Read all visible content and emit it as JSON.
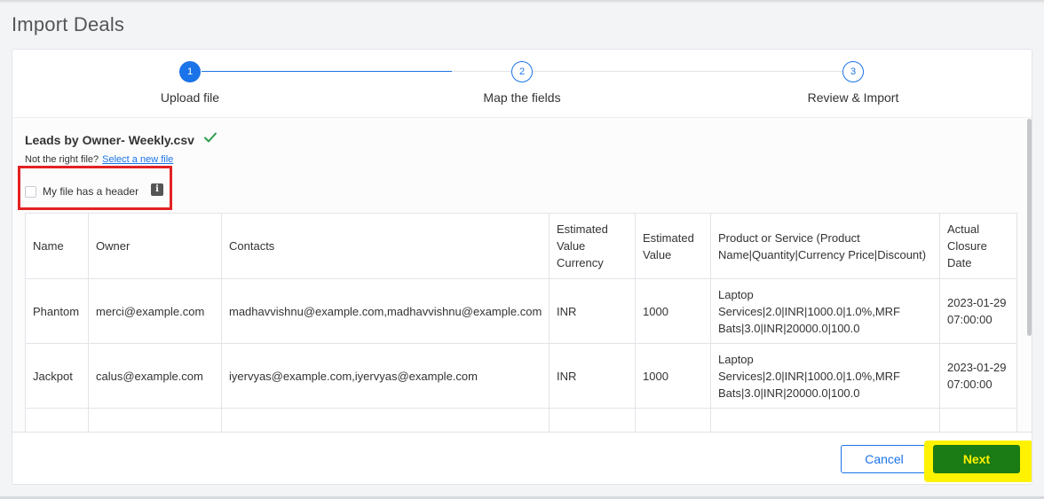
{
  "page": {
    "title": "Import Deals"
  },
  "stepper": {
    "steps": [
      {
        "number": "1",
        "label": "Upload file",
        "state": "active"
      },
      {
        "number": "2",
        "label": "Map the fields",
        "state": "idle"
      },
      {
        "number": "3",
        "label": "Review & Import",
        "state": "idle"
      }
    ]
  },
  "file": {
    "name": "Leads by Owner- Weekly.csv",
    "status_icon": "check-icon",
    "wrong_file_text": "Not the right file?",
    "select_new_link": "Select a new file"
  },
  "header_option": {
    "label": "My file has a header",
    "checked": false,
    "info_icon_glyph": "i"
  },
  "table": {
    "columns": [
      "Name",
      "Owner",
      "Contacts",
      "Estimated Value Currency",
      "Estimated Value",
      "Product or Service (Product Name|Quantity|Currency Price|Discount)",
      "Actual Closure Date"
    ],
    "rows": [
      [
        "Phantom",
        "merci@example.com",
        "madhavvishnu@example.com,madhavvishnu@example.com",
        "INR",
        "1000",
        "Laptop Services|2.0|INR|1000.0|1.0%,MRF Bats|3.0|INR|20000.0|100.0",
        "2023-01-29 07:00:00"
      ],
      [
        "Jackpot",
        "calus@example.com",
        "iyervyas@example.com,iyervyas@example.com",
        "INR",
        "1000",
        "Laptop Services|2.0|INR|1000.0|1.0%,MRF Bats|3.0|INR|20000.0|100.0",
        "2023-01-29 07:00:00"
      ],
      [
        "",
        "",
        "",
        "",
        "",
        "",
        ""
      ]
    ]
  },
  "footer": {
    "cancel_label": "Cancel",
    "next_label": "Next"
  },
  "colors": {
    "primary": "#1a73e8",
    "annotation_red": "#e32222",
    "highlight_yellow": "#fff200",
    "next_green": "#1b7b15",
    "success_check": "#2e9d4a"
  }
}
